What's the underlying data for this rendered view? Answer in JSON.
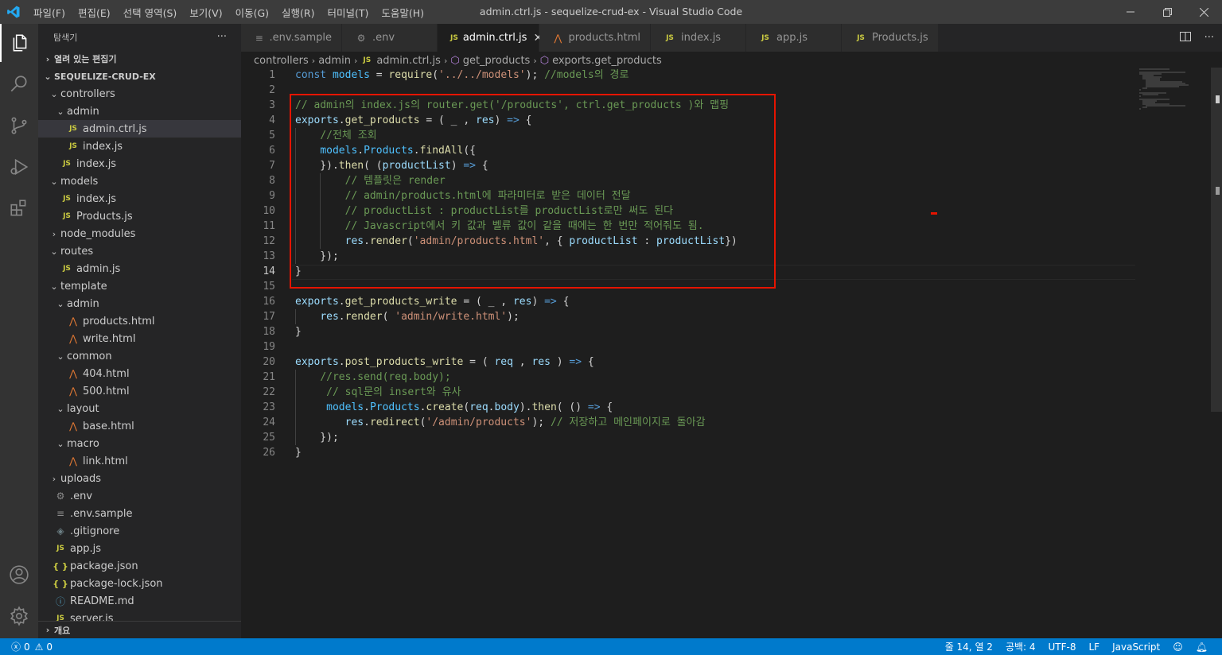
{
  "menu": [
    "파일(F)",
    "편집(E)",
    "선택 영역(S)",
    "보기(V)",
    "이동(G)",
    "실행(R)",
    "터미널(T)",
    "도움말(H)"
  ],
  "window_title": "admin.ctrl.js - sequelize-crud-ex - Visual Studio Code",
  "sidebar": {
    "title": "탐색기",
    "more": "···",
    "open_editors": "열려 있는 편집기",
    "project": "SEQUELIZE-CRUD-EX",
    "tree": [
      {
        "label": "controllers",
        "type": "folder",
        "open": true,
        "depth": 1
      },
      {
        "label": "admin",
        "type": "folder",
        "open": true,
        "depth": 2
      },
      {
        "label": "admin.ctrl.js",
        "type": "js",
        "depth": 3,
        "selected": true
      },
      {
        "label": "index.js",
        "type": "js",
        "depth": 3
      },
      {
        "label": "index.js",
        "type": "js",
        "depth": 2
      },
      {
        "label": "models",
        "type": "folder",
        "open": true,
        "depth": 1
      },
      {
        "label": "index.js",
        "type": "js",
        "depth": 2
      },
      {
        "label": "Products.js",
        "type": "js",
        "depth": 2
      },
      {
        "label": "node_modules",
        "type": "folder",
        "open": false,
        "depth": 1
      },
      {
        "label": "routes",
        "type": "folder",
        "open": true,
        "depth": 1
      },
      {
        "label": "admin.js",
        "type": "js",
        "depth": 2
      },
      {
        "label": "template",
        "type": "folder",
        "open": true,
        "depth": 1
      },
      {
        "label": "admin",
        "type": "folder",
        "open": true,
        "depth": 2
      },
      {
        "label": "products.html",
        "type": "html",
        "depth": 3
      },
      {
        "label": "write.html",
        "type": "html",
        "depth": 3
      },
      {
        "label": "common",
        "type": "folder",
        "open": true,
        "depth": 2
      },
      {
        "label": "404.html",
        "type": "html",
        "depth": 3
      },
      {
        "label": "500.html",
        "type": "html",
        "depth": 3
      },
      {
        "label": "layout",
        "type": "folder",
        "open": true,
        "depth": 2
      },
      {
        "label": "base.html",
        "type": "html",
        "depth": 3
      },
      {
        "label": "macro",
        "type": "folder",
        "open": true,
        "depth": 2
      },
      {
        "label": "link.html",
        "type": "html",
        "depth": 3
      },
      {
        "label": "uploads",
        "type": "folder",
        "open": false,
        "depth": 1
      },
      {
        "label": ".env",
        "type": "gear",
        "depth": 1
      },
      {
        "label": ".env.sample",
        "type": "lines",
        "depth": 1
      },
      {
        "label": ".gitignore",
        "type": "git",
        "depth": 1
      },
      {
        "label": "app.js",
        "type": "js",
        "depth": 1
      },
      {
        "label": "package.json",
        "type": "json",
        "depth": 1
      },
      {
        "label": "package-lock.json",
        "type": "json",
        "depth": 1
      },
      {
        "label": "README.md",
        "type": "info",
        "depth": 1
      },
      {
        "label": "server.js",
        "type": "js",
        "depth": 1
      }
    ],
    "outline": "개요"
  },
  "tabs": [
    {
      "label": ".env.sample",
      "type": "lines"
    },
    {
      "label": ".env",
      "type": "gear"
    },
    {
      "label": "admin.ctrl.js",
      "type": "js",
      "active": true
    },
    {
      "label": "products.html",
      "type": "html"
    },
    {
      "label": "index.js",
      "type": "js"
    },
    {
      "label": "app.js",
      "type": "js"
    },
    {
      "label": "Products.js",
      "type": "js"
    }
  ],
  "breadcrumb": [
    "controllers",
    "admin",
    "admin.ctrl.js",
    "get_products",
    "exports.get_products"
  ],
  "code": [
    [
      [
        "k",
        "const "
      ],
      [
        "v",
        "models"
      ],
      [
        "o",
        " = "
      ],
      [
        "f",
        "require"
      ],
      [
        "o",
        "("
      ],
      [
        "s",
        "'../../models'"
      ],
      [
        "o",
        "); "
      ],
      [
        "c",
        "//models의 경로"
      ]
    ],
    [],
    [
      [
        "c",
        "// admin의 index.js의 router.get('/products', ctrl.get_products )와 맵핑"
      ]
    ],
    [
      [
        "p",
        "exports"
      ],
      [
        "o",
        "."
      ],
      [
        "f",
        "get_products"
      ],
      [
        "o",
        " = ( _ , "
      ],
      [
        "p",
        "res"
      ],
      [
        "o",
        ") "
      ],
      [
        "k",
        "=>"
      ],
      [
        "o",
        " {"
      ]
    ],
    [
      [
        "o",
        "    "
      ],
      [
        "c",
        "//전체 조회"
      ]
    ],
    [
      [
        "o",
        "    "
      ],
      [
        "v",
        "models"
      ],
      [
        "o",
        "."
      ],
      [
        "v",
        "Products"
      ],
      [
        "o",
        "."
      ],
      [
        "f",
        "findAll"
      ],
      [
        "o",
        "({"
      ]
    ],
    [
      [
        "o",
        "    })."
      ],
      [
        "f",
        "then"
      ],
      [
        "o",
        "( ("
      ],
      [
        "p",
        "productList"
      ],
      [
        "o",
        ") "
      ],
      [
        "k",
        "=>"
      ],
      [
        "o",
        " {"
      ]
    ],
    [
      [
        "o",
        "        "
      ],
      [
        "c",
        "// 템플릿은 render"
      ]
    ],
    [
      [
        "o",
        "        "
      ],
      [
        "c",
        "// admin/products.html에 파라미터로 받은 데이터 전달"
      ]
    ],
    [
      [
        "o",
        "        "
      ],
      [
        "c",
        "// productList : productList를 productList로만 써도 된다"
      ]
    ],
    [
      [
        "o",
        "        "
      ],
      [
        "c",
        "// Javascript에서 키 값과 벨류 값이 같을 때에는 한 번만 적어줘도 됨."
      ]
    ],
    [
      [
        "o",
        "        "
      ],
      [
        "p",
        "res"
      ],
      [
        "o",
        "."
      ],
      [
        "f",
        "render"
      ],
      [
        "o",
        "("
      ],
      [
        "s",
        "'admin/products.html'"
      ],
      [
        "o",
        ", { "
      ],
      [
        "p",
        "productList"
      ],
      [
        "o",
        " : "
      ],
      [
        "p",
        "productList"
      ],
      [
        "o",
        "})"
      ]
    ],
    [
      [
        "o",
        "    });"
      ]
    ],
    [
      [
        "o",
        "}"
      ]
    ],
    [],
    [
      [
        "p",
        "exports"
      ],
      [
        "o",
        "."
      ],
      [
        "f",
        "get_products_write"
      ],
      [
        "o",
        " = ( _ , "
      ],
      [
        "p",
        "res"
      ],
      [
        "o",
        ") "
      ],
      [
        "k",
        "=>"
      ],
      [
        "o",
        " {"
      ]
    ],
    [
      [
        "o",
        "    "
      ],
      [
        "p",
        "res"
      ],
      [
        "o",
        "."
      ],
      [
        "f",
        "render"
      ],
      [
        "o",
        "( "
      ],
      [
        "s",
        "'admin/write.html'"
      ],
      [
        "o",
        ");"
      ]
    ],
    [
      [
        "o",
        "}"
      ]
    ],
    [],
    [
      [
        "p",
        "exports"
      ],
      [
        "o",
        "."
      ],
      [
        "f",
        "post_products_write"
      ],
      [
        "o",
        " = ( "
      ],
      [
        "p",
        "req"
      ],
      [
        "o",
        " , "
      ],
      [
        "p",
        "res"
      ],
      [
        "o",
        " ) "
      ],
      [
        "k",
        "=>"
      ],
      [
        "o",
        " {"
      ]
    ],
    [
      [
        "o",
        "    "
      ],
      [
        "c",
        "//res.send(req.body);"
      ]
    ],
    [
      [
        "o",
        "     "
      ],
      [
        "c",
        "// sql문의 insert와 유사"
      ]
    ],
    [
      [
        "o",
        "     "
      ],
      [
        "v",
        "models"
      ],
      [
        "o",
        "."
      ],
      [
        "v",
        "Products"
      ],
      [
        "o",
        "."
      ],
      [
        "f",
        "create"
      ],
      [
        "o",
        "("
      ],
      [
        "p",
        "req"
      ],
      [
        "o",
        "."
      ],
      [
        "p",
        "body"
      ],
      [
        "o",
        ")."
      ],
      [
        "f",
        "then"
      ],
      [
        "o",
        "( () "
      ],
      [
        "k",
        "=>"
      ],
      [
        "o",
        " {"
      ]
    ],
    [
      [
        "o",
        "        "
      ],
      [
        "p",
        "res"
      ],
      [
        "o",
        "."
      ],
      [
        "f",
        "redirect"
      ],
      [
        "o",
        "("
      ],
      [
        "s",
        "'/admin/products'"
      ],
      [
        "o",
        "); "
      ],
      [
        "c",
        "// 저장하고 메인페이지로 돌아감"
      ]
    ],
    [
      [
        "o",
        "    });"
      ]
    ],
    [
      [
        "o",
        "}"
      ]
    ]
  ],
  "status": {
    "errors": "0",
    "warnings": "0",
    "position": "줄 14, 열 2",
    "spaces": "공백: 4",
    "encoding": "UTF-8",
    "eol": "LF",
    "language": "JavaScript"
  },
  "colors": {
    "accent": "#007acc",
    "highlight": "#e51400"
  }
}
